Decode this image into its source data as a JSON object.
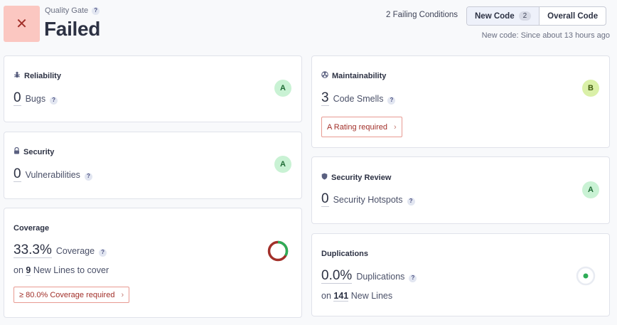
{
  "quality_gate": {
    "label": "Quality Gate",
    "status": "Failed",
    "status_icon": "close-icon",
    "status_color": "#a2302a"
  },
  "header": {
    "failing_conditions": "2 Failing Conditions",
    "tabs": [
      {
        "label": "New Code",
        "count": "2"
      },
      {
        "label": "Overall Code"
      }
    ],
    "new_code_note": "New code: Since about 13 hours ago"
  },
  "cards": {
    "reliability": {
      "title": "Reliability",
      "value": "0",
      "label": "Bugs",
      "rating": "A"
    },
    "security": {
      "title": "Security",
      "value": "0",
      "label": "Vulnerabilities",
      "rating": "A"
    },
    "coverage": {
      "title": "Coverage",
      "value": "33.3%",
      "label": "Coverage",
      "sub_prefix": "on",
      "sub_value": "9",
      "sub_suffix": "New Lines to cover",
      "requirement": "≥ 80.0% Coverage required",
      "percent": 33.3
    },
    "maintainability": {
      "title": "Maintainability",
      "value": "3",
      "label": "Code Smells",
      "rating": "B",
      "requirement": "A Rating required"
    },
    "security_review": {
      "title": "Security Review",
      "value": "0",
      "label": "Security Hotspots",
      "rating": "A"
    },
    "duplications": {
      "title": "Duplications",
      "value": "0.0%",
      "label": "Duplications",
      "sub_prefix": "on",
      "sub_value": "141",
      "sub_suffix": "New Lines"
    }
  },
  "colors": {
    "rating_a": "#c9f2d4",
    "rating_b": "#daf0a8",
    "fail": "#a2302a",
    "coverage_ok": "#2eac56"
  }
}
